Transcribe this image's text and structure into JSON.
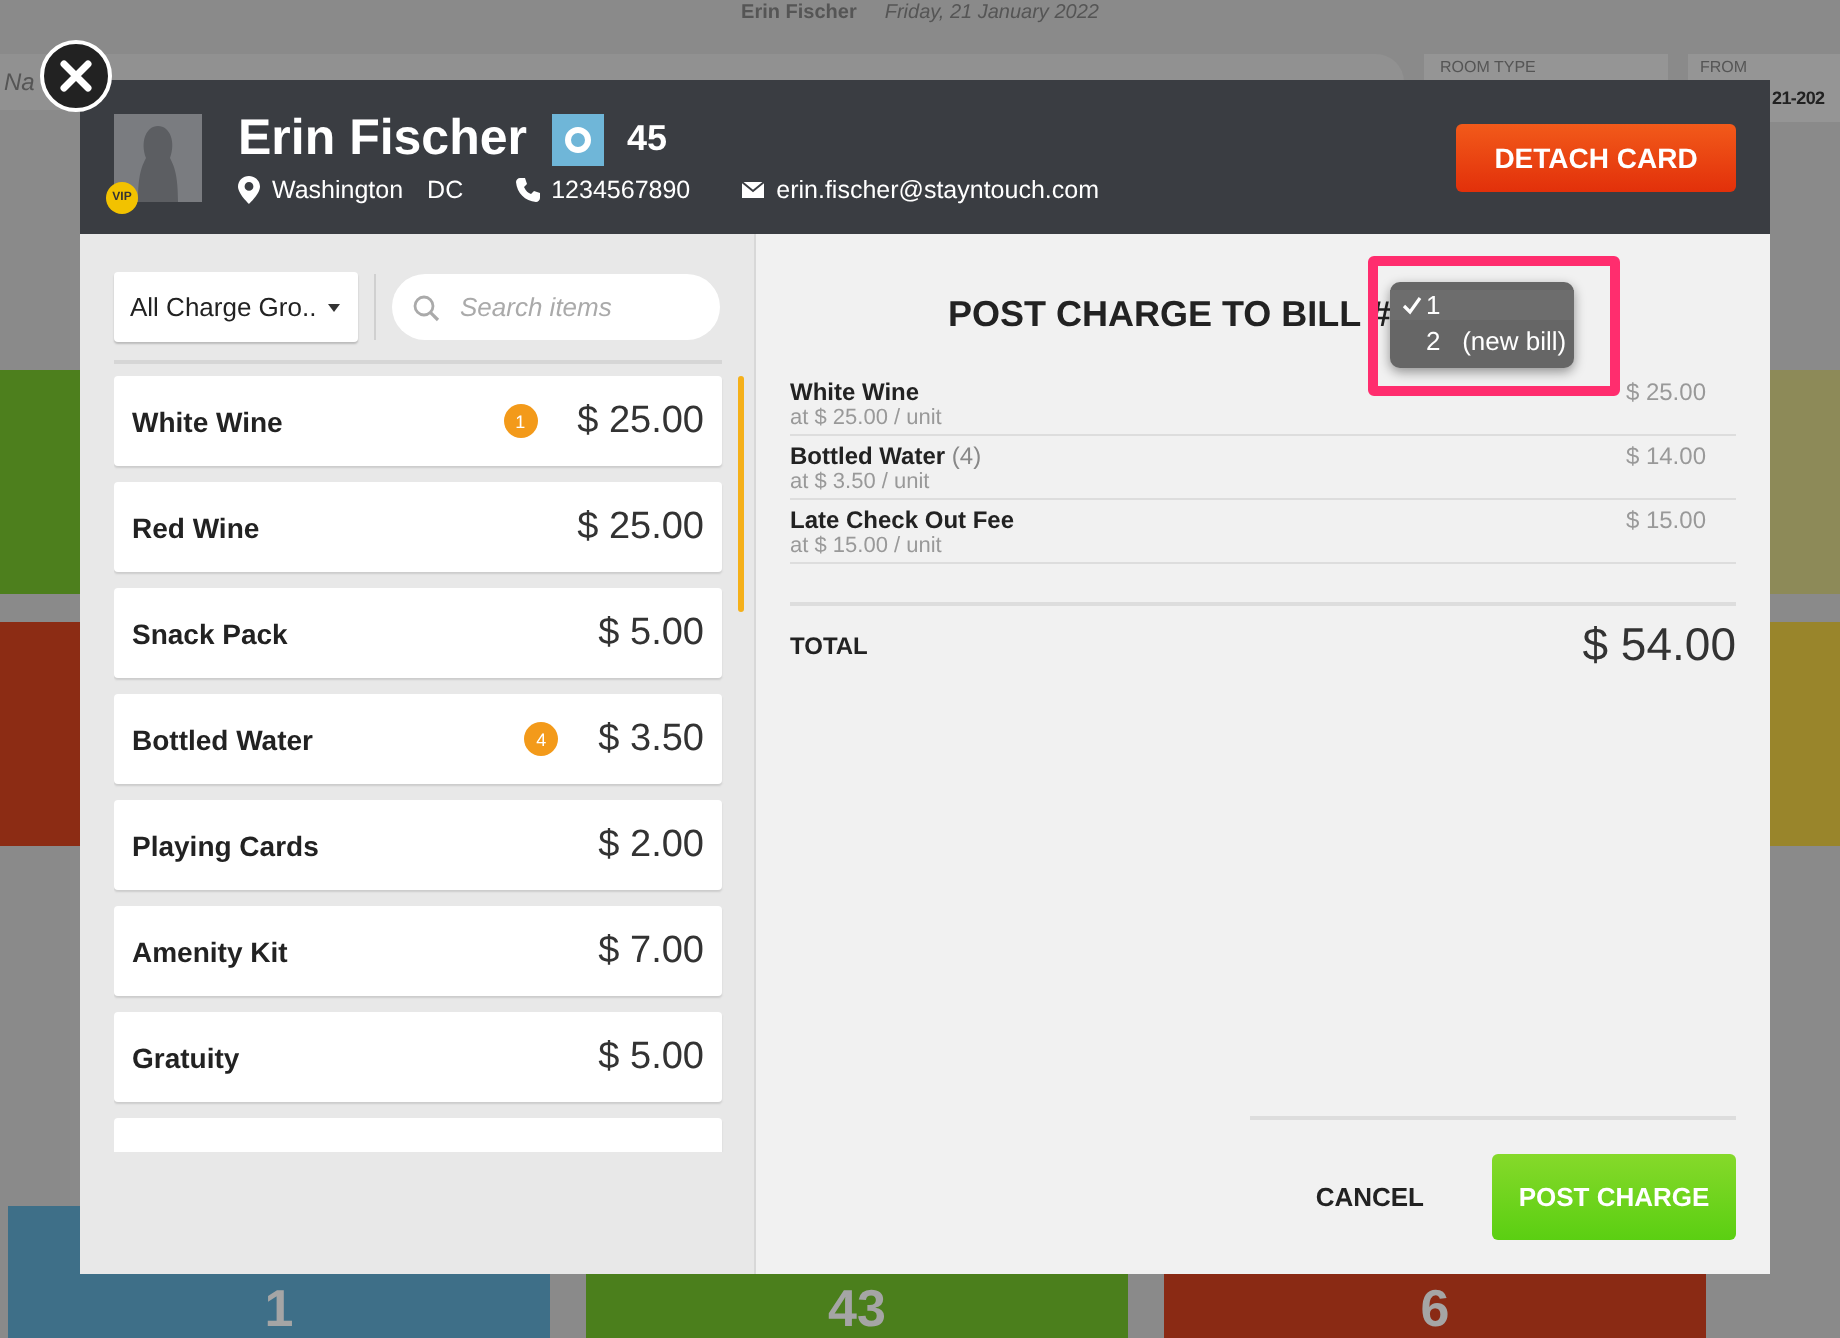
{
  "backdrop": {
    "header_name": "Erin Fischer",
    "header_date": "Friday, 21 January 2022",
    "search_value": "Na",
    "room_type_label": "ROOM TYPE",
    "from_label": "FROM",
    "from_value": "21-202",
    "tiles": [
      {
        "number": "1",
        "color": "#3e6f88"
      },
      {
        "number": "43",
        "color": "#4b7f1c"
      },
      {
        "number": "6",
        "color": "#8a2a14"
      }
    ]
  },
  "guest": {
    "name": "Erin Fischer",
    "vip_badge": "VIP",
    "room_number": "45",
    "city": "Washington",
    "state": "DC",
    "phone": "1234567890",
    "email": "erin.fischer@stayntouch.com"
  },
  "detach_button": "DETACH CARD",
  "filter": {
    "charge_group": "All Charge Gro..",
    "search_placeholder": "Search items"
  },
  "items": [
    {
      "name": "White Wine",
      "price": "$ 25.00",
      "count": "1"
    },
    {
      "name": "Red Wine",
      "price": "$ 25.00"
    },
    {
      "name": "Snack Pack",
      "price": "$ 5.00"
    },
    {
      "name": "Bottled Water",
      "price": "$ 3.50",
      "count": "4"
    },
    {
      "name": "Playing Cards",
      "price": "$ 2.00"
    },
    {
      "name": "Amenity Kit",
      "price": "$ 7.00"
    },
    {
      "name": "Gratuity",
      "price": "$ 5.00"
    }
  ],
  "bill": {
    "title": "POST CHARGE TO BILL #",
    "options": [
      {
        "label": "1",
        "selected": true
      },
      {
        "label": "2   (new bill)",
        "selected": false
      }
    ],
    "lines": [
      {
        "name": "White Wine",
        "unit": "at $ 25.00 / unit",
        "amount": "$ 25.00"
      },
      {
        "name": "Bottled Water",
        "quantity": "(4)",
        "unit": "at $ 3.50 / unit",
        "amount": "$ 14.00"
      },
      {
        "name": "Late Check Out Fee",
        "unit": "at $ 15.00 / unit",
        "amount": "$ 15.00"
      }
    ],
    "total_label": "TOTAL",
    "total": "$ 54.00"
  },
  "buttons": {
    "cancel": "CANCEL",
    "post": "POST CHARGE"
  }
}
